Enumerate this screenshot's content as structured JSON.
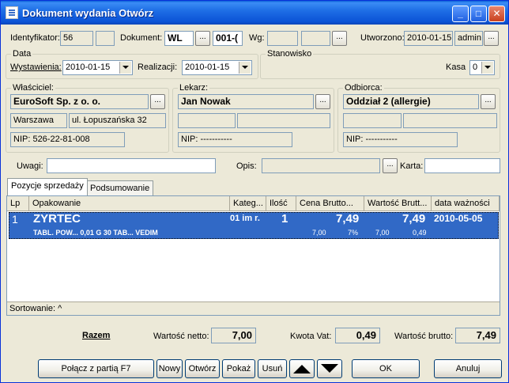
{
  "window": {
    "title": "Dokument wydania Otwórz",
    "minimize": "_",
    "maximize": "□",
    "close": "✕"
  },
  "header": {
    "identifikator_label": "Identyfikator:",
    "identifikator_value": "56",
    "identifikator_extra": "",
    "dokument_label": "Dokument:",
    "dokument_value": "WL",
    "dokument_number": "001-(",
    "wg_label": "Wg:",
    "wg_value1": "",
    "wg_value2": "",
    "utworzono_label": "Utworzono:",
    "utworzono_date": "2010-01-15",
    "utworzono_user": "admin",
    "dots": "..."
  },
  "data_group": {
    "title": "Data",
    "wystawienia_label": "Wystawienia:",
    "wystawienia_value": "2010-01-15",
    "realizacji_label": "Realizacji:",
    "realizacji_value": "2010-01-15"
  },
  "stanowisko": {
    "title": "Stanowisko",
    "kasa_label": "Kasa",
    "kasa_value": "0"
  },
  "wlasciciel": {
    "title": "Właściciel:",
    "name": "EuroSoft Sp. z o. o.",
    "city": "Warszawa",
    "street": "ul. Łopuszańska 32",
    "nip": "NIP: 526-22-81-008"
  },
  "lekarz": {
    "title": "Lekarz:",
    "name": "Jan Nowak",
    "nip": "NIP: -----------"
  },
  "odbiorca": {
    "title": "Odbiorca:",
    "name": "Oddział 2 (allergie)",
    "nip": "NIP: -----------"
  },
  "notes": {
    "uwagi_label": "Uwagi:",
    "uwagi_value": "",
    "opis_label": "Opis:",
    "opis_value": "",
    "karta_label": "Karta:",
    "karta_value": ""
  },
  "tabs": [
    {
      "label": "Pozycje sprzedaży"
    },
    {
      "label": "Podsumowanie"
    }
  ],
  "grid": {
    "columns": [
      "Lp",
      "Opakowanie",
      "Kateg...",
      "Ilość",
      "Cena Brutto...",
      "Wartość Brutt...",
      "data ważności"
    ],
    "row": {
      "lp": "1",
      "name": "ZYRTEC",
      "kateg": "01 im r.",
      "ilosc": "1",
      "cena": "7,49",
      "wartosc": "7,49",
      "data": "2010-05-05",
      "desc": "TABL. POW...  0,01 G  30 TAB...  VEDIM",
      "sub_cena": "7,00",
      "sub_vat": "7%",
      "sub_netto": "7,00",
      "sub_vat_amount": "0,49"
    },
    "status": "Sortowanie: ^"
  },
  "summary": {
    "razem": "Razem",
    "netto_label": "Wartość netto:",
    "netto_value": "7,00",
    "vat_label": "Kwota Vat:",
    "vat_value": "0,49",
    "brutto_label": "Wartość brutto:",
    "brutto_value": "7,49"
  },
  "buttons": {
    "polacz": "Połącz z partią F7",
    "nowy": "Nowy",
    "otworz": "Otwórz",
    "pokaz": "Pokaż",
    "usun": "Usuń",
    "ok": "OK",
    "anuluj": "Anuluj"
  }
}
